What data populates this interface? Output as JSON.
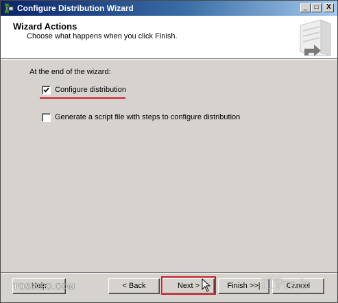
{
  "window": {
    "title": "Configure Distribution Wizard",
    "icon": "wizard-app-icon",
    "controls": {
      "minimize": "_",
      "maximize": "□",
      "close": "X"
    }
  },
  "header": {
    "title": "Wizard Actions",
    "subtitle": "Choose what happens when you click Finish.",
    "graphic": "server-graphic-icon"
  },
  "body": {
    "prompt": "At the end of the wizard:",
    "options": [
      {
        "label": "Configure distribution",
        "checked": true
      },
      {
        "label": "Generate a script file with steps to configure distribution",
        "checked": false
      }
    ]
  },
  "buttons": {
    "help": "Help",
    "back": "< Back",
    "next": "Next >",
    "finish": "Finish >>|",
    "cancel": "Cancel"
  },
  "watermark": {
    "left": "TOSINSO.COM",
    "right": "ITPro.ir"
  },
  "colors": {
    "titlebar_start": "#0a246a",
    "titlebar_end": "#a6caf0",
    "dialog_bg": "#d6d3ce",
    "annotation_red": "#d11f2a"
  }
}
